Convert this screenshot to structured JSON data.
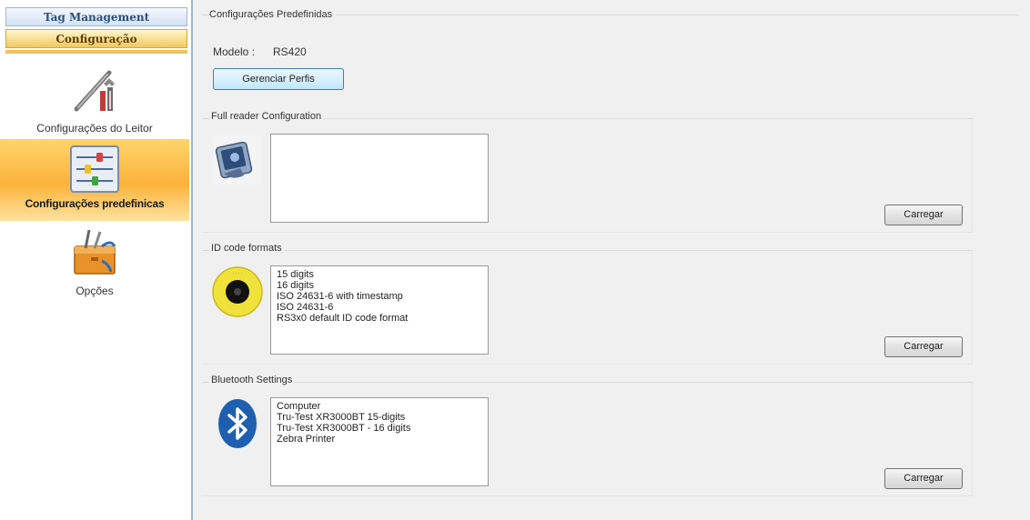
{
  "sidebar": {
    "tabs": [
      {
        "label": "Tag Management"
      },
      {
        "label": "Configuração"
      }
    ],
    "items": [
      {
        "label": "Configurações do Leitor",
        "icon": "tools-icon"
      },
      {
        "label": "Configurações predefinicas",
        "icon": "sliders-icon",
        "selected": true
      },
      {
        "label": "Opções",
        "icon": "toolbox-icon"
      }
    ]
  },
  "main": {
    "title": "Configurações Predefinidas",
    "model_label": "Modelo :",
    "model_value": "RS420",
    "manage_button": "Gerenciar Perfis",
    "groups": [
      {
        "title": "Full reader Configuration",
        "icon": "reader-device-icon",
        "items": [],
        "button": "Carregar"
      },
      {
        "title": "ID code formats",
        "icon": "eartag-icon",
        "items": [
          "15 digits",
          "16 digits",
          "ISO 24631-6 with timestamp",
          "ISO 24631-6",
          "RS3x0 default ID code format"
        ],
        "button": "Carregar"
      },
      {
        "title": "Bluetooth Settings",
        "icon": "bluetooth-icon",
        "items": [
          "Computer",
          "Tru-Test XR3000BT 15-digits",
          "Tru-Test XR3000BT - 16 digits",
          "Zebra Printer"
        ],
        "button": "Carregar"
      }
    ]
  },
  "colors": {
    "selected_item": "#fbb33a",
    "config_tab": "#f3c85e",
    "bluetooth": "#1e5fb0"
  }
}
